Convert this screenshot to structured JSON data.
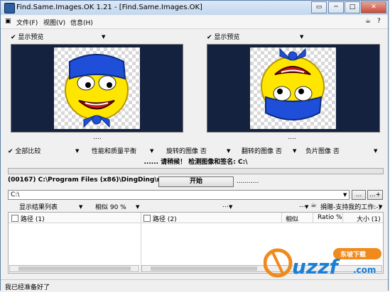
{
  "window": {
    "title": "Find.Same.Images.OK 1.21 - [Find.Same.Images.OK]",
    "controls": {
      "menu": "▭",
      "minimize": "─",
      "maximize": "□",
      "close": "✕"
    },
    "extra_icons": [
      "cup-icon",
      "help-icon"
    ]
  },
  "menubar": {
    "file": "文件(F)",
    "view": "视图(V)",
    "info": "信息(H)"
  },
  "left_panel": {
    "check_label": "✔ 显示预览",
    "dots": "...."
  },
  "right_panel": {
    "check_label": "✔ 显示预览",
    "dots": "...."
  },
  "options": {
    "compare_all": "✔ 全部比较",
    "performance": "性能和质量平衡",
    "rotated": "旋转的图像 否",
    "flipped": "翻转的图像 否",
    "negative": "负片图像 否"
  },
  "status_message": "...... 请稍候！ 检测图像和签名: C:\\",
  "current_path": "(00167) C:\\Program Files (x86)\\DingDing\\main\\c",
  "start_button": "开始",
  "path_trailer": "...........",
  "directory": {
    "value": "C:\\",
    "browse": "...",
    "add": "...+"
  },
  "results_toolbar": {
    "show_list": "显示结果列表",
    "similarity": "相似 90 %",
    "ellipsis1": "...",
    "ellipsis2": "...",
    "donate": "捐赠-支持我的工作:-)"
  },
  "table": {
    "columns": [
      "路径 (1)",
      "路径 (2)",
      "相似",
      "Ratio %",
      "大小 (1)"
    ]
  },
  "statusbar": {
    "text": "我已经准备好了"
  },
  "watermark": {
    "text": "uzzf",
    "sub": "东坡下载",
    "domain": ".com"
  },
  "colors": {
    "preview_bg": "#14213f",
    "face_yellow": "#ffe600",
    "hat_blue": "#1f4fd8",
    "watermark_orange": "#f08a1c"
  }
}
